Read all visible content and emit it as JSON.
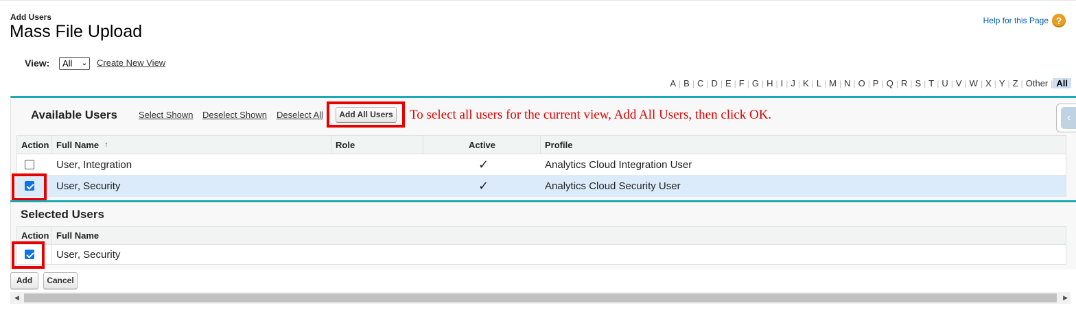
{
  "header": {
    "subtitle": "Add Users",
    "title": "Mass File Upload",
    "help_link": "Help for this Page",
    "help_icon": "?"
  },
  "view": {
    "label": "View:",
    "selected": "All",
    "create_link": "Create New View"
  },
  "alphabet": [
    "A",
    "B",
    "C",
    "D",
    "E",
    "F",
    "G",
    "H",
    "I",
    "J",
    "K",
    "L",
    "M",
    "N",
    "O",
    "P",
    "Q",
    "R",
    "S",
    "T",
    "U",
    "V",
    "W",
    "X",
    "Y",
    "Z",
    "Other",
    "All"
  ],
  "alphabet_active": "All",
  "available": {
    "title": "Available Users",
    "links": {
      "select_shown": "Select Shown",
      "deselect_shown": "Deselect Shown",
      "deselect_all": "Deselect All"
    },
    "add_all_button": "Add All Users",
    "annotation": "To select all users for the current view, Add All Users, then click OK.",
    "columns": {
      "action": "Action",
      "full_name": "Full Name",
      "sort_arrow": "↑",
      "role": "Role",
      "active": "Active",
      "profile": "Profile"
    },
    "rows": [
      {
        "checked": false,
        "full_name": "User, Integration",
        "role": "",
        "active": "✓",
        "profile": "Analytics Cloud Integration User"
      },
      {
        "checked": true,
        "full_name": "User, Security",
        "role": "",
        "active": "✓",
        "profile": "Analytics Cloud Security User"
      }
    ]
  },
  "selected": {
    "title": "Selected Users",
    "columns": {
      "action": "Action",
      "full_name": "Full Name"
    },
    "rows": [
      {
        "checked": true,
        "full_name": "User, Security"
      }
    ]
  },
  "buttons": {
    "add": "Add",
    "cancel": "Cancel"
  },
  "colors": {
    "accent_teal": "#1aaab3",
    "annotation_red": "#e60000",
    "link_blue": "#015ba7",
    "selected_row": "#dcebfa",
    "checkbox_blue": "#0b73e6"
  }
}
